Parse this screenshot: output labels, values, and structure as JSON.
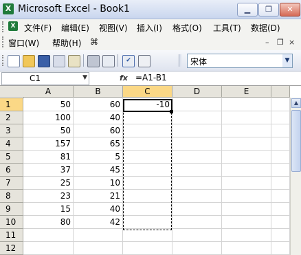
{
  "window": {
    "title": "Microsoft Excel - Book1",
    "app_icon": "X"
  },
  "window_controls": {
    "minimize": "▁",
    "restore": "❐",
    "close": "✕"
  },
  "menu": {
    "row1": [
      "文件(F)",
      "编辑(E)",
      "视图(V)",
      "插入(I)",
      "格式(O)",
      "工具(T)",
      "数据(D)"
    ],
    "row2": [
      "窗口(W)",
      "帮助(H)"
    ],
    "doc_controls": {
      "minimize": "–",
      "restore": "❐",
      "close": "×"
    }
  },
  "toolbar": {
    "icons": [
      "new-icon",
      "open-icon",
      "save-icon",
      "permission-icon",
      "email-icon",
      "print-icon",
      "print-preview-icon",
      "spelling-icon",
      "research-icon"
    ],
    "font_name": "宋体"
  },
  "formula_bar": {
    "name_box": "C1",
    "fx_label": "fx",
    "formula": "=A1-B1"
  },
  "grid": {
    "columns": [
      "A",
      "B",
      "C",
      "D",
      "E"
    ],
    "selected_column": "C",
    "rows": [
      {
        "num": "1",
        "a": "50",
        "b": "60",
        "c": "-10"
      },
      {
        "num": "2",
        "a": "100",
        "b": "40",
        "c": ""
      },
      {
        "num": "3",
        "a": "50",
        "b": "60",
        "c": ""
      },
      {
        "num": "4",
        "a": "157",
        "b": "65",
        "c": ""
      },
      {
        "num": "5",
        "a": "81",
        "b": "5",
        "c": ""
      },
      {
        "num": "6",
        "a": "37",
        "b": "45",
        "c": ""
      },
      {
        "num": "7",
        "a": "25",
        "b": "10",
        "c": ""
      },
      {
        "num": "8",
        "a": "23",
        "b": "21",
        "c": ""
      },
      {
        "num": "9",
        "a": "15",
        "b": "40",
        "c": ""
      },
      {
        "num": "10",
        "a": "80",
        "b": "42",
        "c": ""
      },
      {
        "num": "11",
        "a": "",
        "b": "",
        "c": ""
      },
      {
        "num": "12",
        "a": "",
        "b": "",
        "c": ""
      }
    ]
  },
  "colors": {
    "selection_header": "#fbd886",
    "title_gradient_top": "#e9eef8"
  }
}
